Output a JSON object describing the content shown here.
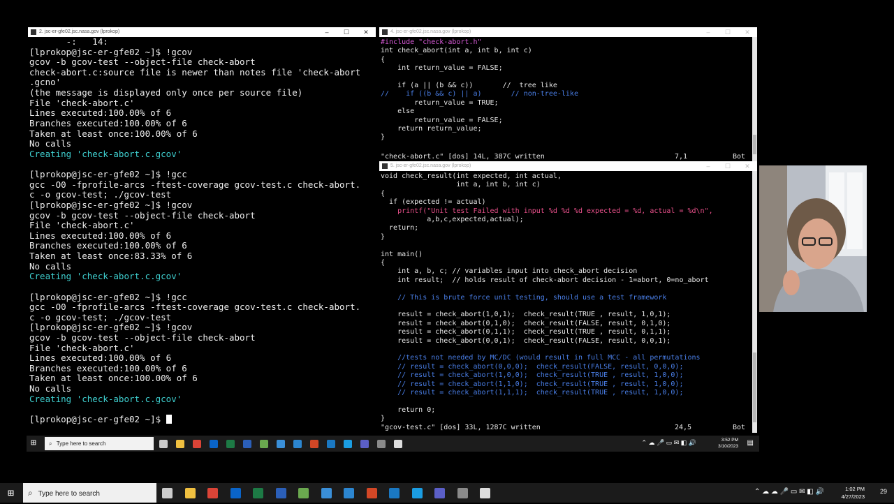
{
  "left_window": {
    "title": "2. jsc-er-gfe02.jsc.nasa.gov (lprokop)",
    "controls": [
      "–",
      "☐",
      "✕"
    ],
    "lines": [
      {
        "text": "       -:   14:",
        "style": "normal"
      },
      {
        "text": "[lprokop@jsc-er-gfe02 ~]$ !gcov",
        "style": "normal"
      },
      {
        "text": "gcov -b gcov-test --object-file check-abort",
        "style": "normal"
      },
      {
        "text": "check-abort.c:source file is newer than notes file 'check-abort",
        "style": "normal"
      },
      {
        "text": ".gcno'",
        "style": "normal"
      },
      {
        "text": "(the message is displayed only once per source file)",
        "style": "normal"
      },
      {
        "text": "File 'check-abort.c'",
        "style": "normal"
      },
      {
        "text": "Lines executed:100.00% of 6",
        "style": "normal"
      },
      {
        "text": "Branches executed:100.00% of 6",
        "style": "normal"
      },
      {
        "text": "Taken at least once:100.00% of 6",
        "style": "normal"
      },
      {
        "text": "No calls",
        "style": "normal"
      },
      {
        "text": "Creating 'check-abort.c.gcov'",
        "style": "cyan"
      },
      {
        "text": "",
        "style": "normal"
      },
      {
        "text": "[lprokop@jsc-er-gfe02 ~]$ !gcc",
        "style": "normal"
      },
      {
        "text": "gcc -O0 -fprofile-arcs -ftest-coverage gcov-test.c check-abort.",
        "style": "normal"
      },
      {
        "text": "c -o gcov-test; ./gcov-test",
        "style": "normal"
      },
      {
        "text": "[lprokop@jsc-er-gfe02 ~]$ !gcov",
        "style": "normal"
      },
      {
        "text": "gcov -b gcov-test --object-file check-abort",
        "style": "normal"
      },
      {
        "text": "File 'check-abort.c'",
        "style": "normal"
      },
      {
        "text": "Lines executed:100.00% of 6",
        "style": "normal"
      },
      {
        "text": "Branches executed:100.00% of 6",
        "style": "normal"
      },
      {
        "text": "Taken at least once:83.33% of 6",
        "style": "normal"
      },
      {
        "text": "No calls",
        "style": "normal"
      },
      {
        "text": "Creating 'check-abort.c.gcov'",
        "style": "cyan"
      },
      {
        "text": "",
        "style": "normal"
      },
      {
        "text": "[lprokop@jsc-er-gfe02 ~]$ !gcc",
        "style": "normal"
      },
      {
        "text": "gcc -O0 -fprofile-arcs -ftest-coverage gcov-test.c check-abort.",
        "style": "normal"
      },
      {
        "text": "c -o gcov-test; ./gcov-test",
        "style": "normal"
      },
      {
        "text": "[lprokop@jsc-er-gfe02 ~]$ !gcov",
        "style": "normal"
      },
      {
        "text": "gcov -b gcov-test --object-file check-abort",
        "style": "normal"
      },
      {
        "text": "File 'check-abort.c'",
        "style": "normal"
      },
      {
        "text": "Lines executed:100.00% of 6",
        "style": "normal"
      },
      {
        "text": "Branches executed:100.00% of 6",
        "style": "normal"
      },
      {
        "text": "Taken at least once:100.00% of 6",
        "style": "normal"
      },
      {
        "text": "No calls",
        "style": "normal"
      },
      {
        "text": "Creating 'check-abort.c.gcov'",
        "style": "cyan"
      },
      {
        "text": "",
        "style": "normal"
      }
    ],
    "prompt": "[lprokop@jsc-er-gfe02 ~]$ "
  },
  "top_right_window": {
    "title": "4. jsc-er-gfe02.jsc.nasa.gov (lprokop)",
    "controls": [
      "–",
      "☐",
      "✕"
    ],
    "lines": [
      {
        "text": "#include \"check-abort.h\"",
        "style": "pre"
      },
      {
        "text": "int check_abort(int a, int b, int c)",
        "style": "normal"
      },
      {
        "text": "{",
        "style": "normal"
      },
      {
        "text": "    int return_value = FALSE;",
        "style": "normal"
      },
      {
        "text": "",
        "style": "normal"
      },
      {
        "text": "    if (a || (b && c))       //  tree like",
        "style": "normal"
      },
      {
        "text": "//    if ((b && c) || a)       // non-tree-like",
        "style": "cm"
      },
      {
        "text": "        return_value = TRUE;",
        "style": "normal"
      },
      {
        "text": "    else",
        "style": "normal"
      },
      {
        "text": "        return_value = FALSE;",
        "style": "normal"
      },
      {
        "text": "    return return_value;",
        "style": "normal"
      },
      {
        "text": "}",
        "style": "normal"
      }
    ],
    "status": {
      "file": "\"check-abort.c\" [dos] 14L, 387C written",
      "pos": "7,1",
      "where": "Bot"
    }
  },
  "bottom_right_window": {
    "title": "5. jsc-er-gfe02.jsc.nasa.gov (lprokop)",
    "controls": [
      "–",
      "☐",
      "✕"
    ],
    "lines": [
      {
        "text": "void check_result(int expected, int actual,",
        "style": "normal"
      },
      {
        "text": "                  int a, int b, int c)",
        "style": "normal"
      },
      {
        "text": "{",
        "style": "normal"
      },
      {
        "text": "  if (expected != actual)",
        "style": "normal"
      },
      {
        "text": "    printf(\"Unit test Failed with input %d %d %d expected = %d, actual = %d\\n\",",
        "style": "str"
      },
      {
        "text": "           a,b,c,expected,actual);",
        "style": "normal"
      },
      {
        "text": "  return;",
        "style": "normal"
      },
      {
        "text": "}",
        "style": "normal"
      },
      {
        "text": "",
        "style": "normal"
      },
      {
        "text": "int main()",
        "style": "normal"
      },
      {
        "text": "{",
        "style": "normal"
      },
      {
        "text": "    int a, b, c; // variables input into check_abort decision",
        "style": "normal"
      },
      {
        "text": "    int result;  // holds result of check-abort decision - 1=abort, 0=no_abort",
        "style": "normal"
      },
      {
        "text": "",
        "style": "normal"
      },
      {
        "text": "    // This is brute force unit testing, should use a test framework",
        "style": "cm"
      },
      {
        "text": "",
        "style": "normal"
      },
      {
        "text": "    result = check_abort(1,0,1);  check_result(TRUE , result, 1,0,1);",
        "style": "normal"
      },
      {
        "text": "    result = check_abort(0,1,0);  check_result(FALSE, result, 0,1,0);",
        "style": "normal"
      },
      {
        "text": "    result = check_abort(0,1,1);  check_result(TRUE , result, 0,1,1);",
        "style": "normal"
      },
      {
        "text": "    result = check_abort(0,0,1);  check_result(FALSE, result, 0,0,1);",
        "style": "normal"
      },
      {
        "text": "",
        "style": "normal"
      },
      {
        "text": "    //tests not needed by MC/DC (would result in full MCC - all permutations",
        "style": "cm"
      },
      {
        "text": "    // result = check_abort(0,0,0);  check_result(FALSE, result, 0,0,0);",
        "style": "cm"
      },
      {
        "text": "    // result = check_abort(1,0,0);  check_result(TRUE , result, 1,0,0);",
        "style": "cm"
      },
      {
        "text": "    // result = check_abort(1,1,0);  check_result(TRUE , result, 1,0,0);",
        "style": "cm"
      },
      {
        "text": "    // result = check_abort(1,1,1);  check_result(TRUE , result, 1,0,0);",
        "style": "cm"
      },
      {
        "text": "",
        "style": "normal"
      },
      {
        "text": "    return 0;",
        "style": "normal"
      },
      {
        "text": "}",
        "style": "normal"
      }
    ],
    "status": {
      "file": "\"gcov-test.c\" [dos] 33L, 1287C written",
      "pos": "24,5",
      "where": "Bot"
    }
  },
  "inner_taskbar": {
    "search_placeholder": "Type here to search",
    "time": "3:52 PM",
    "date": "3/10/2023",
    "notification_count": ""
  },
  "outer_taskbar": {
    "search_placeholder": "Type here to search",
    "time": "1:02 PM",
    "date": "4/27/2023",
    "notification_count": "29"
  },
  "taskbar_icons": [
    {
      "name": "task-view-icon",
      "color": "#cccccc"
    },
    {
      "name": "file-explorer-icon",
      "color": "#f0c040"
    },
    {
      "name": "chrome-icon",
      "color": "#db4437"
    },
    {
      "name": "outlook-icon",
      "color": "#0a64c8"
    },
    {
      "name": "excel-icon",
      "color": "#1d7a45"
    },
    {
      "name": "word-icon",
      "color": "#2b5fb8"
    },
    {
      "name": "project-icon",
      "color": "#6aa84f"
    },
    {
      "name": "share-icon",
      "color": "#3a8fd8"
    },
    {
      "name": "mail-icon",
      "color": "#2c86d0"
    },
    {
      "name": "powerpoint-icon",
      "color": "#d24726"
    },
    {
      "name": "calculator-icon",
      "color": "#1a78c2"
    },
    {
      "name": "edge-icon",
      "color": "#1b9de2"
    },
    {
      "name": "teams-icon",
      "color": "#5b5fc7"
    },
    {
      "name": "screen-share-icon",
      "color": "#8a8a8a"
    },
    {
      "name": "settings-icon",
      "color": "#dddddd"
    }
  ]
}
